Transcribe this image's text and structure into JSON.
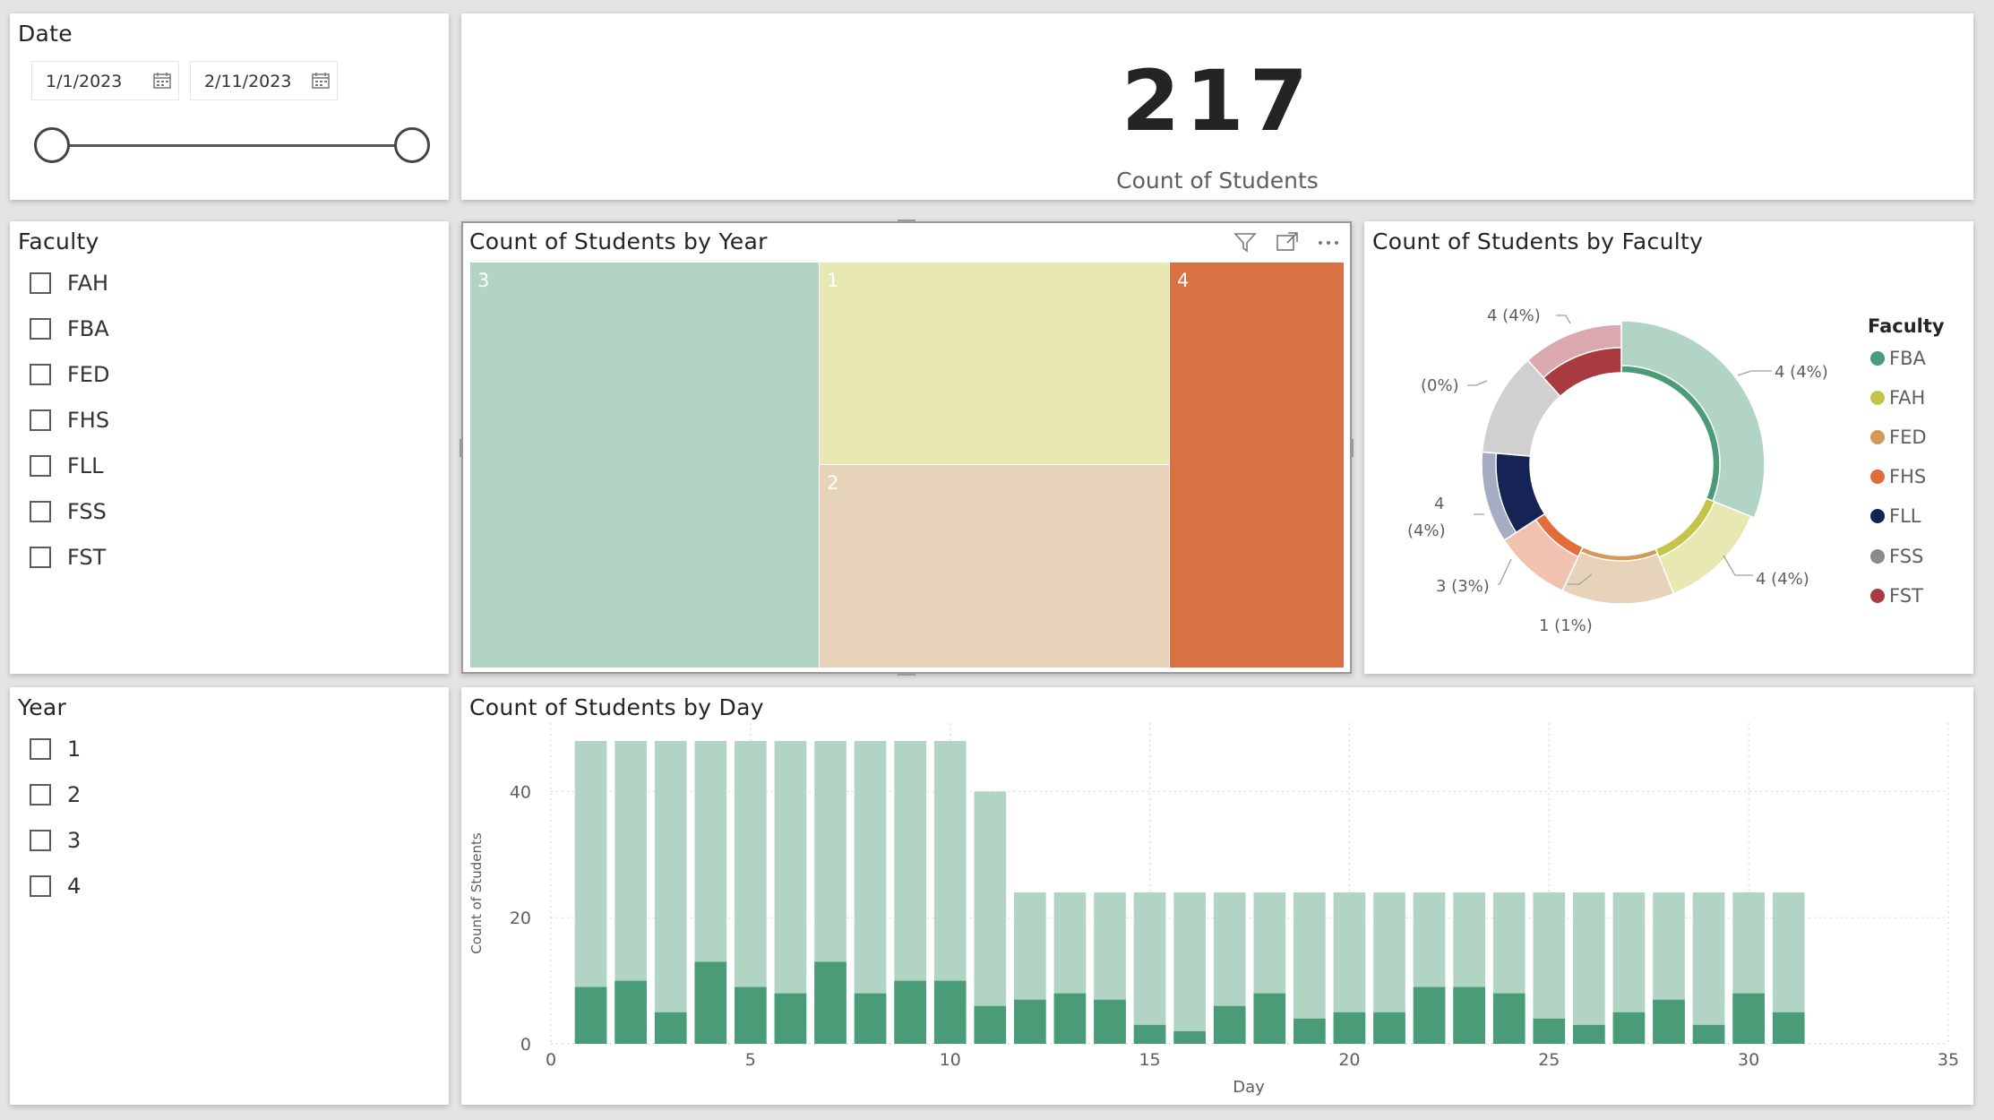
{
  "date_slicer": {
    "title": "Date",
    "start_date": "1/1/2023",
    "end_date": "2/11/2023",
    "range_fraction": [
      0,
      1
    ]
  },
  "faculty_slicer": {
    "title": "Faculty",
    "items": [
      "FAH",
      "FBA",
      "FED",
      "FHS",
      "FLL",
      "FSS",
      "FST"
    ]
  },
  "year_slicer": {
    "title": "Year",
    "items": [
      "1",
      "2",
      "3",
      "4"
    ]
  },
  "kpi": {
    "value": "217",
    "label": "Count of Students"
  },
  "treemap": {
    "title": "Count of Students by Year",
    "cells": [
      {
        "label": "3",
        "color": "#b2d4c5"
      },
      {
        "label": "1",
        "color": "#e8e8b2"
      },
      {
        "label": "2",
        "color": "#e6d3b9"
      },
      {
        "label": "4",
        "color": "#d97243"
      }
    ],
    "header_icons": [
      "filter-icon",
      "focus-mode-icon",
      "more-options-icon"
    ]
  },
  "donut": {
    "title": "Count of Students by Faculty",
    "legend_title": "Faculty",
    "legend": [
      {
        "name": "FBA",
        "color": "#4a9b77"
      },
      {
        "name": "FAH",
        "color": "#c4c548"
      },
      {
        "name": "FED",
        "color": "#d49a5a"
      },
      {
        "name": "FHS",
        "color": "#e46c3a"
      },
      {
        "name": "FLL",
        "color": "#152454"
      },
      {
        "name": "FSS",
        "color": "#8a8a8a"
      },
      {
        "name": "FST",
        "color": "#a83a40"
      }
    ],
    "data_labels": {
      "fba": "4 (4%)",
      "fah": "4 (4%)",
      "fed": "1 (1%)",
      "fhs": "3 (3%)",
      "fll_1": "4",
      "fll_2": "(4%)",
      "fss": "(0%)",
      "fst": "4 (4%)"
    }
  },
  "chart_data": {
    "type": "bar",
    "title": "Count of Students by Day",
    "xlabel": "Day",
    "ylabel": "Count of Students",
    "xlim": [
      0,
      35
    ],
    "ylim": [
      0,
      48
    ],
    "xticks": [
      0,
      5,
      10,
      15,
      20,
      25,
      30,
      35
    ],
    "yticks": [
      0,
      20,
      40
    ],
    "grid": true,
    "x": [
      1,
      2,
      3,
      4,
      5,
      6,
      7,
      8,
      9,
      10,
      11,
      12,
      13,
      14,
      15,
      16,
      17,
      18,
      19,
      20,
      21,
      22,
      23,
      24,
      25,
      26,
      27,
      28,
      29,
      30,
      31
    ],
    "series": [
      {
        "color": "#b2d4c5",
        "values": [
          48,
          48,
          48,
          48,
          48,
          48,
          48,
          48,
          48,
          48,
          40,
          24,
          24,
          24,
          24,
          24,
          24,
          24,
          24,
          24,
          24,
          24,
          24,
          24,
          24,
          24,
          24,
          24,
          24,
          24,
          24
        ]
      },
      {
        "color": "#4a9b77",
        "values": [
          9,
          10,
          5,
          13,
          9,
          8,
          13,
          8,
          10,
          10,
          6,
          7,
          8,
          7,
          3,
          2,
          6,
          8,
          4,
          5,
          5,
          9,
          9,
          8,
          4,
          3,
          5,
          7,
          3,
          8,
          5
        ]
      }
    ]
  }
}
